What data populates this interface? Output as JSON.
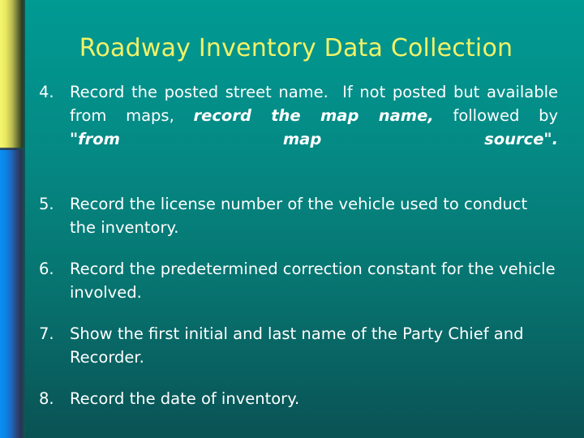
{
  "slide": {
    "title": "Roadway Inventory Data Collection",
    "title_color": "#f2f266",
    "background_top_color": "#009a93",
    "background_bottom_color": "#0a5254",
    "accent_stripe_top_color": "#f6f66e",
    "accent_stripe_bottom_color": "#0a8ff2",
    "body_text_color": "#ffffff"
  },
  "items": [
    {
      "number": "4.",
      "line1_plain": "Record the posted street name.",
      "line1_plain_b": "If not posted but",
      "line2_plain": "available from maps,",
      "line2_em": "record the map name,",
      "line3_plain": "followed by",
      "line3_em": "\"from map source\"."
    },
    {
      "number": "5.",
      "text": "Record the license number of the vehicle used to conduct the inventory."
    },
    {
      "number": "6.",
      "text": "Record the predetermined correction constant for the vehicle involved."
    },
    {
      "number": "7.",
      "text": "Show the first initial and last name of the Party Chief and Recorder."
    },
    {
      "number": "8.",
      "text": "Record the date of inventory."
    }
  ]
}
